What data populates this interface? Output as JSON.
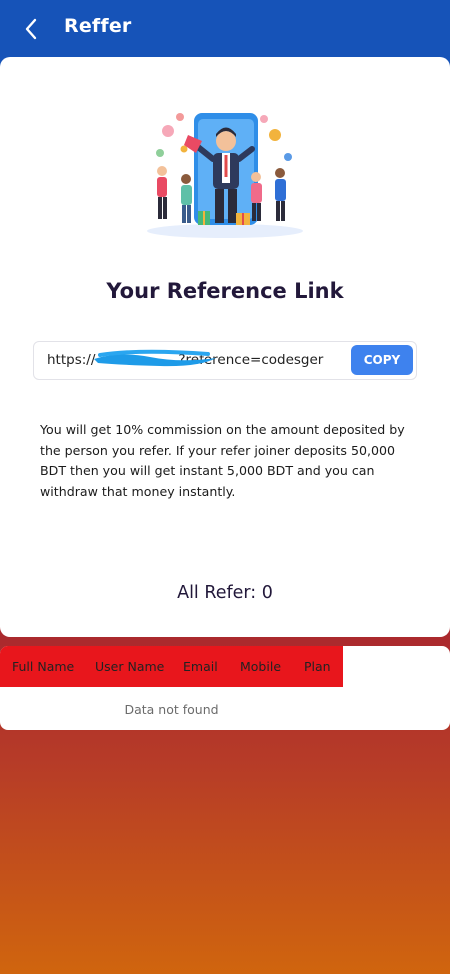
{
  "header": {
    "title": "Reffer",
    "back_icon": "chevron-left-icon"
  },
  "main": {
    "illustration": "referral-illustration",
    "reference_title": "Your Reference Link",
    "link": {
      "prefix": "https://",
      "suffix": "?reference=codesger"
    },
    "copy_label": "COPY",
    "commission_text": "You will get 10% commission on the amount deposited by the person you refer. If your refer joiner deposits 50,000 BDT then you will get instant 5,000 BDT and you can withdraw that money instantly.",
    "all_refer": "All Refer: 0"
  },
  "table": {
    "columns": [
      "Full Name",
      "User Name",
      "Email",
      "Mobile",
      "Plan"
    ],
    "empty_message": "Data not found"
  },
  "colors": {
    "header_bg": "#1653b8",
    "copy_button": "#3e82ee",
    "table_header_bg": "#e8161c",
    "title_text": "#22183a"
  }
}
